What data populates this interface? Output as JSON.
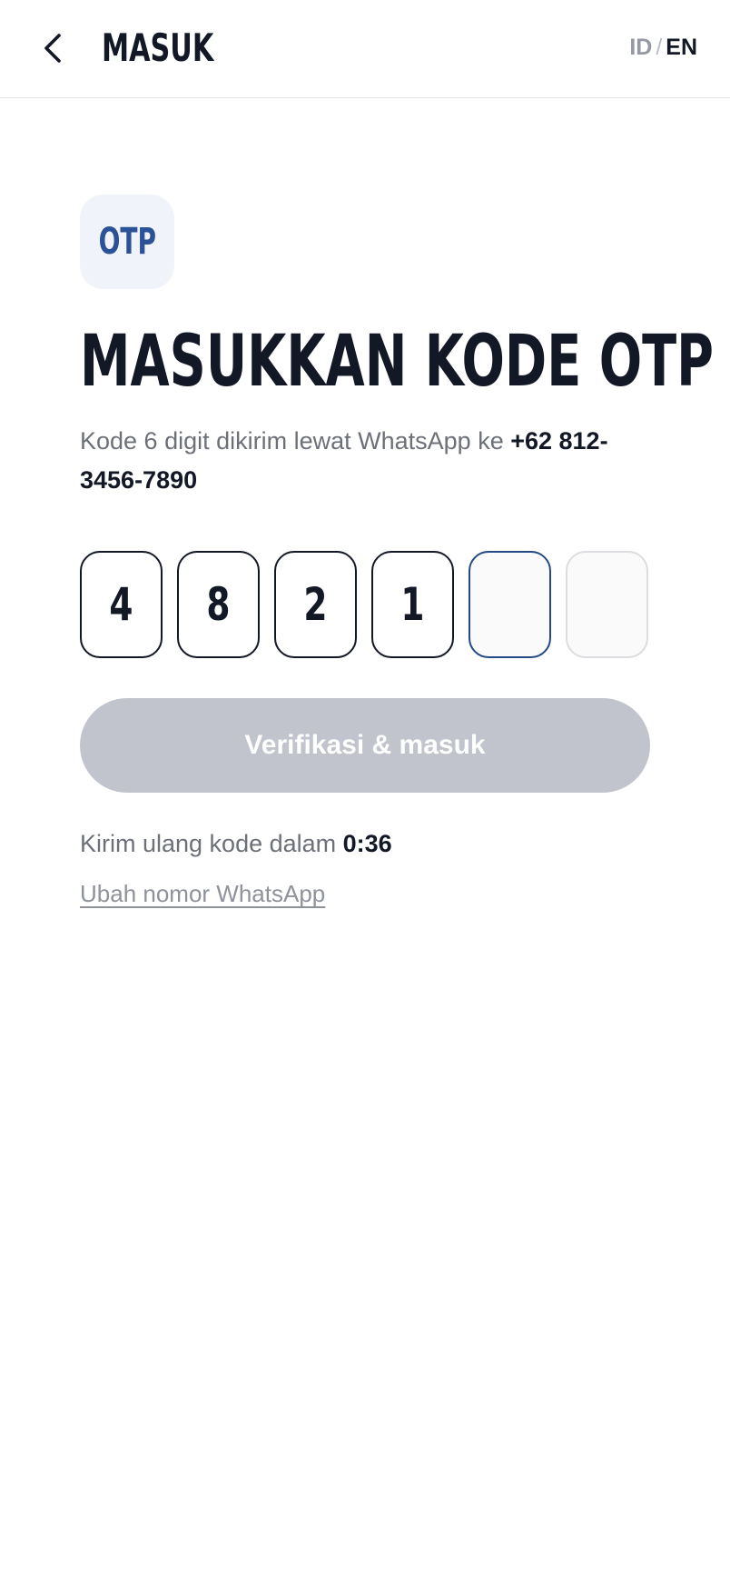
{
  "header": {
    "title": "MASUK",
    "back_icon": "chevron-left-icon",
    "lang": {
      "id_label": "ID",
      "separator": "/",
      "en_label": "EN",
      "selected": "EN"
    }
  },
  "main": {
    "badge_label": "OTP",
    "title": "MASUKKAN KODE OTP",
    "subtitle_prefix": "Kode 6 digit dikirim lewat WhatsApp ke ",
    "phone": "+62 812-3456-7890",
    "otp_digits": [
      "4",
      "8",
      "2",
      "1",
      "",
      ""
    ],
    "verify_label": "Verifikasi & masuk",
    "resend_prefix": "Kirim ulang kode dalam ",
    "resend_timer": "0:36",
    "change_number_label": "Ubah nomor WhatsApp"
  },
  "colors": {
    "primary_text": "#121826",
    "muted_text": "#6c7079",
    "accent_blue": "#2b5296",
    "badge_bg": "#f0f3fa",
    "disabled_button": "#c1c4cc",
    "active_box_border": "#234a85"
  }
}
